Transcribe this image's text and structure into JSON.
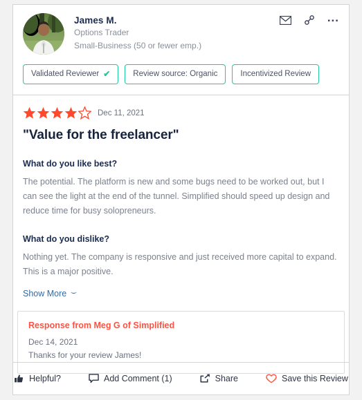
{
  "reviewer": {
    "name": "James M.",
    "role": "Options Trader",
    "company_size": "Small-Business (50 or fewer emp.)",
    "avatar_alt": "photo-of-man-in-white-shirt-outdoors"
  },
  "header_icons": {
    "email": "envelope-icon",
    "link": "chain-link-icon",
    "more": "..."
  },
  "badges": [
    {
      "label": "Validated Reviewer",
      "check": "✔"
    },
    {
      "label": "Review source: Organic"
    },
    {
      "label": "Incentivized Review"
    }
  ],
  "rating": {
    "value": 4,
    "max": 5,
    "star_color": "#ff492c",
    "date": "Dec 11, 2021"
  },
  "review": {
    "title": "\"Value for the freelancer\"",
    "like_question": "What do you like best?",
    "like_answer": "The potential. The platform is new and some bugs need to be worked out, but I can see the light at the end of the tunnel. Simplified should speed up design and reduce time for busy solopreneurs.",
    "dislike_question": "What do you dislike?",
    "dislike_answer": "Nothing yet. The company is responsive and just received more capital to expand. This is a major positive.",
    "show_more": "Show More"
  },
  "response": {
    "title": "Response from Meg G of Simplified",
    "date": "Dec 14, 2021",
    "text": "Thanks for your review James!",
    "title_color": "#fa5343"
  },
  "footer_actions": [
    {
      "label": "Helpful?",
      "icon": "thumbs-up-icon"
    },
    {
      "label": "Add Comment (1)",
      "icon": "comment-icon"
    },
    {
      "label": "Share",
      "icon": "share-icon"
    },
    {
      "label": "Save this Review",
      "icon": "heart-icon",
      "color": "#fa5343"
    }
  ],
  "theme": {
    "badge_border": "#1ec9a0",
    "link_blue": "#36699c",
    "page_bg": "#f2f2f2"
  }
}
